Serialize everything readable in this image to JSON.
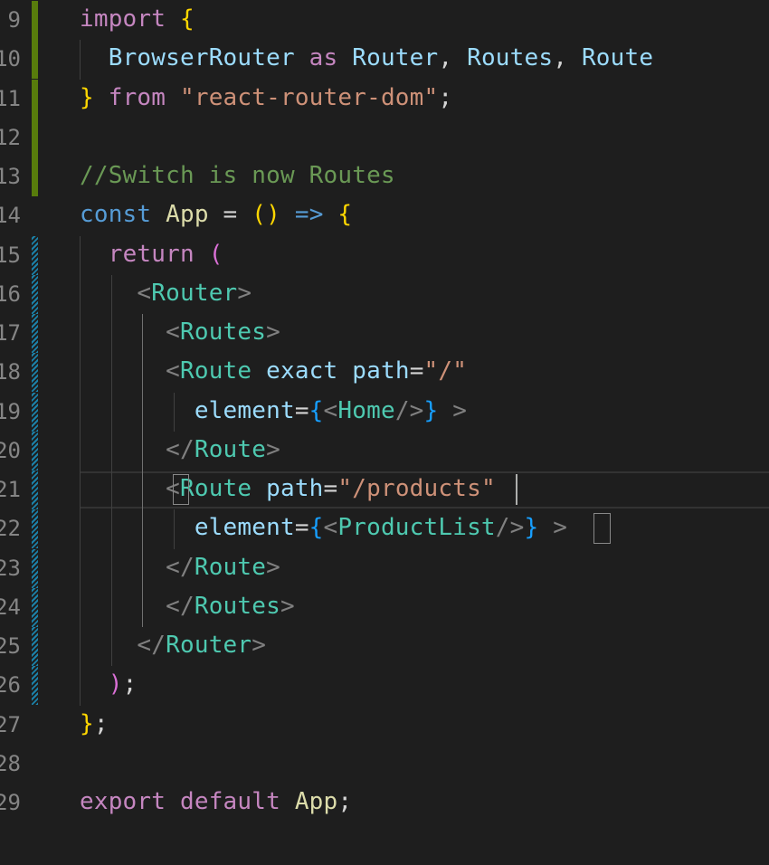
{
  "editor": {
    "lines": [
      {
        "number": "9",
        "gutter": "added",
        "tokens": [
          [
            "kw",
            "import"
          ],
          [
            "pu",
            " "
          ],
          [
            "b1",
            "{"
          ]
        ]
      },
      {
        "number": "10",
        "gutter": "added",
        "tokens": [
          [
            "pu",
            "  "
          ],
          [
            "id",
            "BrowserRouter"
          ],
          [
            "pu",
            " "
          ],
          [
            "kw",
            "as"
          ],
          [
            "pu",
            " "
          ],
          [
            "id",
            "Router"
          ],
          [
            "pu",
            ", "
          ],
          [
            "id",
            "Routes"
          ],
          [
            "pu",
            ", "
          ],
          [
            "id",
            "Route"
          ]
        ]
      },
      {
        "number": "11",
        "gutter": "added",
        "tokens": [
          [
            "b1",
            "}"
          ],
          [
            "pu",
            " "
          ],
          [
            "kw",
            "from"
          ],
          [
            "pu",
            " "
          ],
          [
            "str",
            "\"react-router-dom\""
          ],
          [
            "pu",
            ";"
          ]
        ]
      },
      {
        "number": "12",
        "gutter": "added",
        "tokens": []
      },
      {
        "number": "13",
        "gutter": "added",
        "tokens": [
          [
            "cm",
            "//Switch is now Routes"
          ]
        ]
      },
      {
        "number": "14",
        "gutter": "none",
        "tokens": [
          [
            "st",
            "const"
          ],
          [
            "pu",
            " "
          ],
          [
            "fn",
            "App"
          ],
          [
            "pu",
            " = "
          ],
          [
            "b1",
            "()"
          ],
          [
            "pu",
            " "
          ],
          [
            "st",
            "=>"
          ],
          [
            "pu",
            " "
          ],
          [
            "b1",
            "{"
          ]
        ]
      },
      {
        "number": "15",
        "gutter": "modified",
        "tokens": [
          [
            "pu",
            "  "
          ],
          [
            "kw",
            "return"
          ],
          [
            "pu",
            " "
          ],
          [
            "b2",
            "("
          ]
        ]
      },
      {
        "number": "16",
        "gutter": "modified",
        "tokens": [
          [
            "pu",
            "    "
          ],
          [
            "tg",
            "<"
          ],
          [
            "cls",
            "Router"
          ],
          [
            "tg",
            ">"
          ]
        ]
      },
      {
        "number": "17",
        "gutter": "modified",
        "tokens": [
          [
            "pu",
            "      "
          ],
          [
            "tg",
            "<"
          ],
          [
            "cls",
            "Routes"
          ],
          [
            "tg",
            ">"
          ]
        ]
      },
      {
        "number": "18",
        "gutter": "modified",
        "tokens": [
          [
            "pu",
            "      "
          ],
          [
            "tg",
            "<"
          ],
          [
            "cls",
            "Route"
          ],
          [
            "pu",
            " "
          ],
          [
            "id",
            "exact"
          ],
          [
            "pu",
            " "
          ],
          [
            "id",
            "path"
          ],
          [
            "pu",
            "="
          ],
          [
            "str",
            "\"/\""
          ]
        ]
      },
      {
        "number": "19",
        "gutter": "modified",
        "tokens": [
          [
            "pu",
            "        "
          ],
          [
            "id",
            "element"
          ],
          [
            "pu",
            "="
          ],
          [
            "b3",
            "{"
          ],
          [
            "tg",
            "<"
          ],
          [
            "cls",
            "Home"
          ],
          [
            "tg",
            "/>"
          ],
          [
            "b3",
            "}"
          ],
          [
            "pu",
            " "
          ],
          [
            "tg",
            ">"
          ]
        ]
      },
      {
        "number": "20",
        "gutter": "modified",
        "tokens": [
          [
            "pu",
            "      "
          ],
          [
            "tg",
            "</"
          ],
          [
            "cls",
            "Route"
          ],
          [
            "tg",
            ">"
          ]
        ]
      },
      {
        "number": "21",
        "gutter": "modified",
        "tokens": [
          [
            "pu",
            "      "
          ],
          [
            "tg",
            "<"
          ],
          [
            "cls",
            "Route"
          ],
          [
            "pu",
            " "
          ],
          [
            "id",
            "path"
          ],
          [
            "pu",
            "="
          ],
          [
            "str",
            "\"/products\""
          ]
        ]
      },
      {
        "number": "22",
        "gutter": "modified",
        "tokens": [
          [
            "pu",
            "        "
          ],
          [
            "id",
            "element"
          ],
          [
            "pu",
            "="
          ],
          [
            "b3",
            "{"
          ],
          [
            "tg",
            "<"
          ],
          [
            "cls",
            "ProductList"
          ],
          [
            "tg",
            "/>"
          ],
          [
            "b3",
            "}"
          ],
          [
            "pu",
            " "
          ],
          [
            "tg",
            ">"
          ]
        ]
      },
      {
        "number": "23",
        "gutter": "modified",
        "tokens": [
          [
            "pu",
            "      "
          ],
          [
            "tg",
            "</"
          ],
          [
            "cls",
            "Route"
          ],
          [
            "tg",
            ">"
          ]
        ]
      },
      {
        "number": "24",
        "gutter": "modified",
        "tokens": [
          [
            "pu",
            "      "
          ],
          [
            "tg",
            "</"
          ],
          [
            "cls",
            "Routes"
          ],
          [
            "tg",
            ">"
          ]
        ]
      },
      {
        "number": "25",
        "gutter": "modified",
        "tokens": [
          [
            "pu",
            "    "
          ],
          [
            "tg",
            "</"
          ],
          [
            "cls",
            "Router"
          ],
          [
            "tg",
            ">"
          ]
        ]
      },
      {
        "number": "26",
        "gutter": "modified",
        "tokens": [
          [
            "pu",
            "  "
          ],
          [
            "b2",
            ")"
          ],
          [
            "pu",
            ";"
          ]
        ]
      },
      {
        "number": "27",
        "gutter": "none",
        "tokens": [
          [
            "b1",
            "}"
          ],
          [
            "pu",
            ";"
          ]
        ]
      },
      {
        "number": "28",
        "gutter": "none",
        "tokens": []
      },
      {
        "number": "29",
        "gutter": "none",
        "tokens": [
          [
            "kw",
            "export"
          ],
          [
            "pu",
            " "
          ],
          [
            "kw",
            "default"
          ],
          [
            "pu",
            " "
          ],
          [
            "fn",
            "App"
          ],
          [
            "pu",
            ";"
          ]
        ]
      }
    ],
    "current_line": "21"
  }
}
